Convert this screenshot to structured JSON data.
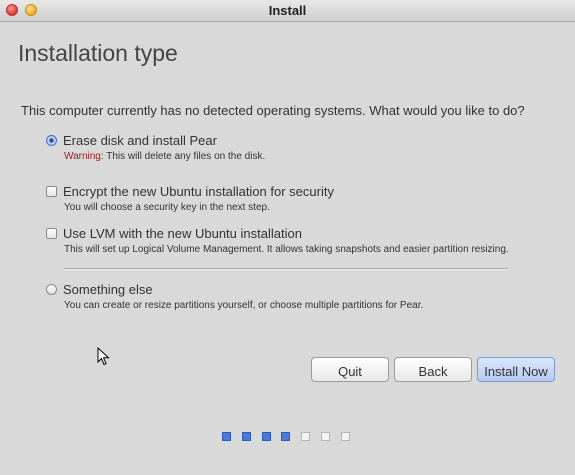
{
  "window": {
    "title": "Install"
  },
  "page": {
    "title": "Installation type",
    "question": "This computer currently has no detected operating systems. What would you like to do?"
  },
  "options": [
    {
      "type": "radio",
      "checked": true,
      "label": "Erase disk and install Pear",
      "warning": "Warning:",
      "description": " This will delete any files on the disk."
    },
    {
      "type": "checkbox",
      "checked": false,
      "label": "Encrypt the new Ubuntu installation for security",
      "description": "You will choose a security key in the next step."
    },
    {
      "type": "checkbox",
      "checked": false,
      "label": "Use LVM with the new Ubuntu installation",
      "description": "This will set up Logical Volume Management. It allows taking snapshots and easier partition resizing."
    },
    {
      "type": "radio",
      "checked": false,
      "label": "Something else",
      "description": "You can create or resize partitions yourself, or choose multiple partitions for Pear."
    }
  ],
  "buttons": {
    "quit": "Quit",
    "back": "Back",
    "install_now": "Install Now"
  },
  "progress": {
    "total_steps": 7,
    "completed_steps": 4
  },
  "colors": {
    "warning": "#a02020",
    "accent": "#4a79d6"
  }
}
